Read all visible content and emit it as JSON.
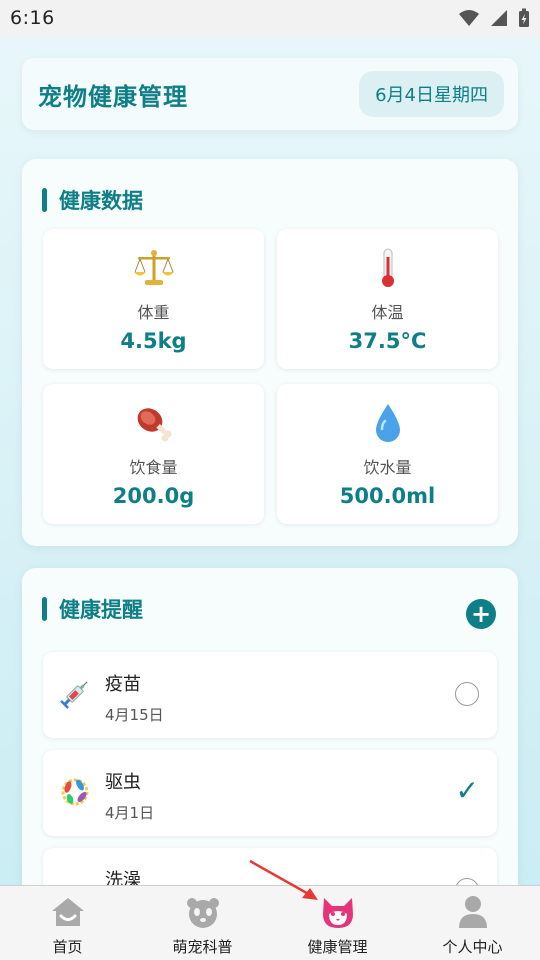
{
  "status_bar": {
    "time": "6:16"
  },
  "header": {
    "title": "宠物健康管理",
    "date": "6月4日星期四"
  },
  "health_data": {
    "title": "健康数据",
    "stats": [
      {
        "icon": "scale-icon",
        "label": "体重",
        "value": "4.5kg"
      },
      {
        "icon": "thermometer-icon",
        "label": "体温",
        "value": "37.5°C"
      },
      {
        "icon": "meat-icon",
        "label": "饮食量",
        "value": "200.0g"
      },
      {
        "icon": "water-drop-icon",
        "label": "饮水量",
        "value": "500.0ml"
      }
    ]
  },
  "reminders": {
    "title": "健康提醒",
    "add_label": "+",
    "items": [
      {
        "icon": "syringe-icon",
        "name": "疫苗",
        "date": "4月15日",
        "done": false
      },
      {
        "icon": "microbe-icon",
        "name": "驱虫",
        "date": "4月1日",
        "done": true,
        "check": "✓"
      },
      {
        "icon": "bath-icon",
        "name": "洗澡",
        "date": "",
        "done": false
      }
    ]
  },
  "nav": {
    "active_color": "#e6347a",
    "items": [
      {
        "icon": "home-icon",
        "label": "首页"
      },
      {
        "icon": "panda-icon",
        "label": "萌宠科普"
      },
      {
        "icon": "pet-face-icon",
        "label": "健康管理"
      },
      {
        "icon": "user-icon",
        "label": "个人中心"
      }
    ]
  },
  "colors": {
    "accent": "#0e7f86",
    "annotation": "#e53935"
  }
}
